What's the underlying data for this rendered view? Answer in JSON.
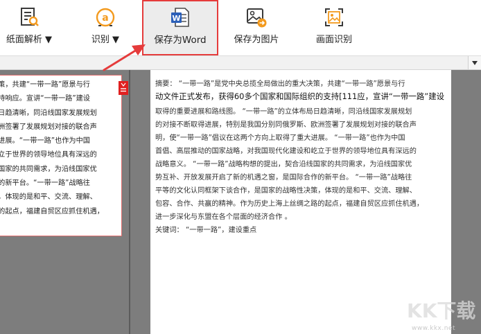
{
  "toolbar": {
    "items": [
      {
        "label": "纸面解析 ▼",
        "icon": "document-search-icon"
      },
      {
        "label": "识别 ▼",
        "icon": "ocr-icon"
      },
      {
        "label": "保存为Word",
        "icon": "word-document-icon"
      },
      {
        "label": "保存为图片",
        "icon": "image-export-icon"
      },
      {
        "label": "画面识别",
        "icon": "screen-recognition-icon"
      }
    ]
  },
  "left_page": {
    "lines": [
      "决策，共建“一带一路”愿景与行",
      "支持响应。宣讲“一带一路”建设",
      "局日趋清晰，同沿线国家发展规划",
      "欧洲签署了发展规划对接的联合声",
      "大进展。“一带一路”也作为中国",
      "屹立于世界的领导地位具有深远的",
      "线国家的共同需求，为沿线国家优",
      "作的新平台。“一带一路”战略往",
      "策，体现的是和平、交流、理解、",
      "路的起点，福建自贸区应抓住机遇，"
    ]
  },
  "right_page": {
    "lines": [
      "摘要：  “一带一路”是党中央总揽全局做出的重大决策，共建“一带一路”愿景与行",
      "动文件正式发布，获得60多个国家和国际组织的支持[111应，宣讲“一带一路”建设",
      "取得的重要进展和路线图。   “一带一路”的立体布局日趋清晰，同沿线国家发展规划",
      "的对接不断取得进展，特别是我国分别同俄罗斯、欧洲签署了发展规划对接的联合声",
      "明，使“一带一路”倡议在这两个方向上取得了重大进展。   “一带一路”也作为中国",
      "首倡、高层推动的国家战略，对我国现代化建设和屹立于世界的领导地位具有深远的",
      "战略意义。   “一带一路”战略构想的提出，契合沿线国家的共同需求，为沿线国家优",
      "势互补、开放发展开启了新的机遇之窗，是国际合作的新平台。   “一带一路”战略往",
      "平等的文化认同框架下谈合作，是国家的战略性决策，体现的是和平、交流、理解、",
      "包容、合作、共赢的精神。作为历史上海上丝绸之路的起点，福建自贸区应抓住机遇，",
      "进一步深化与东盟在各个层面的经济合作 。",
      "关键词：  “一带一路”，建设重点"
    ]
  },
  "watermark": {
    "logo_text": "KK下载",
    "url": "www.kkx.net"
  },
  "colors": {
    "highlight_border": "#e53b3b",
    "arrow": "#e53b3b",
    "workspace": "#7d7d7d"
  }
}
